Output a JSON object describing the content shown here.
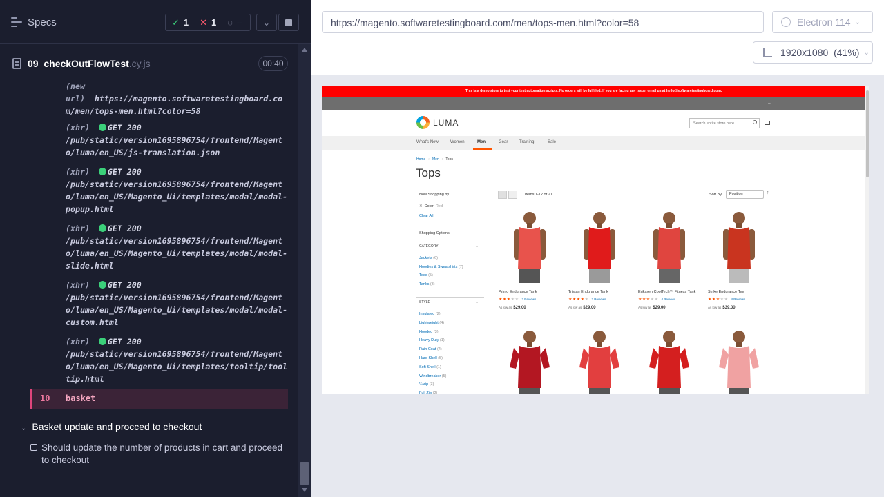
{
  "reporter": {
    "title": "Specs",
    "stats": {
      "passed": "1",
      "failed": "1",
      "pending": "--"
    },
    "file": {
      "name": "09_checkOutFlowTest",
      "ext": ".cy.js",
      "duration": "00:40"
    },
    "log": [
      {
        "kind": "(new url)",
        "method": "",
        "status": "",
        "url": "https://magento.softwaretestingboard.com/men/tops-men.html?color=58"
      },
      {
        "kind": "(xhr)",
        "method": "GET 200",
        "url": "/pub/static/version1695896754/frontend/Magento/luma/en_US/js-translation.json"
      },
      {
        "kind": "(xhr)",
        "method": "GET 200",
        "url": "/pub/static/version1695896754/frontend/Magento/luma/en_US/Magento_Ui/templates/modal/modal-popup.html"
      },
      {
        "kind": "(xhr)",
        "method": "GET 200",
        "url": "/pub/static/version1695896754/frontend/Magento/luma/en_US/Magento_Ui/templates/modal/modal-slide.html"
      },
      {
        "kind": "(xhr)",
        "method": "GET 200",
        "url": "/pub/static/version1695896754/frontend/Magento/luma/en_US/Magento_Ui/templates/modal/modal-custom.html"
      },
      {
        "kind": "(xhr)",
        "method": "GET 200",
        "url": "/pub/static/version1695896754/frontend/Magento/luma/en_US/Magento_Ui/templates/tooltip/tooltip.html"
      }
    ],
    "command": {
      "number": "10",
      "name": "basket"
    },
    "suite": "Basket update and procced to checkout",
    "test": "Should update the number of products in cart and proceed to checkout"
  },
  "aut": {
    "url": "https://magento.softwaretestingboard.com/men/tops-men.html?color=58",
    "browser": "Electron 114",
    "viewport": "1920x1080",
    "zoom": "(41%)"
  },
  "site": {
    "demo_notice": "This is a demo store to test your test automation scripts. No orders will be fulfilled. If you are facing any issue, email us at hello@softwaretestingboard.com.",
    "logo_text": "LUMA",
    "search_placeholder": "Search entire store here...",
    "nav": [
      "What's New",
      "Women",
      "Men",
      "Gear",
      "Training",
      "Sale"
    ],
    "breadcrumbs": [
      "Home",
      "Men",
      "Tops"
    ],
    "page_title": "Tops",
    "now_shopping_by": "Now Shopping by",
    "active_filter_label": "Color:",
    "active_filter_value": "Red",
    "clear_all": "Clear All",
    "shopping_options": "Shopping Options",
    "category_title": "CATEGORY",
    "categories": [
      {
        "name": "Jackets",
        "count": "(6)"
      },
      {
        "name": "Hoodies & Sweatshirts",
        "count": "(7)"
      },
      {
        "name": "Tees",
        "count": "(5)"
      },
      {
        "name": "Tanks",
        "count": "(3)"
      }
    ],
    "style_title": "STYLE",
    "styles": [
      {
        "name": "Insulated",
        "count": "(2)"
      },
      {
        "name": "Lightweight",
        "count": "(4)"
      },
      {
        "name": "Hooded",
        "count": "(3)"
      },
      {
        "name": "Heavy Duty",
        "count": "(1)"
      },
      {
        "name": "Rain Coat",
        "count": "(4)"
      },
      {
        "name": "Hard Shell",
        "count": "(5)"
      },
      {
        "name": "Soft Shell",
        "count": "(1)"
      },
      {
        "name": "Windbreaker",
        "count": "(5)"
      },
      {
        "name": "¼ zip",
        "count": "(3)"
      },
      {
        "name": "Full Zip",
        "count": "(2)"
      }
    ],
    "items_count": "Items 1-12 of 21",
    "sort_by": "Sort By",
    "sort_value": "Position",
    "products": [
      {
        "name": "Primo Endurance Tank",
        "reviews": "3 Reviews",
        "as_low_as": "As low as",
        "price": "$29.00",
        "rating": 2.5,
        "shirt": "#e8534c",
        "shorts": "#555555"
      },
      {
        "name": "Tristan Endurance Tank",
        "reviews": "3 Reviews",
        "as_low_as": "As low as",
        "price": "$29.00",
        "rating": 4,
        "shirt": "#e01b1b",
        "shorts": "#9a9a9a"
      },
      {
        "name": "Erikssen CoolTech™ Fitness Tank",
        "reviews": "4 Reviews",
        "as_low_as": "As low as",
        "price": "$29.00",
        "rating": 3,
        "shirt": "#e0453f",
        "shorts": "#666666"
      },
      {
        "name": "Strike Endurance Tee",
        "reviews": "4 Reviews",
        "as_low_as": "As low as",
        "price": "$39.00",
        "rating": 3,
        "shirt": "#c9341f",
        "shorts": "#bbbbbb"
      },
      {
        "name": "",
        "shirt": "#b31722"
      },
      {
        "name": "",
        "shirt": "#e23f3f"
      },
      {
        "name": "",
        "shirt": "#d41f1f"
      },
      {
        "name": "",
        "shirt": "#f0a2a2"
      }
    ]
  }
}
